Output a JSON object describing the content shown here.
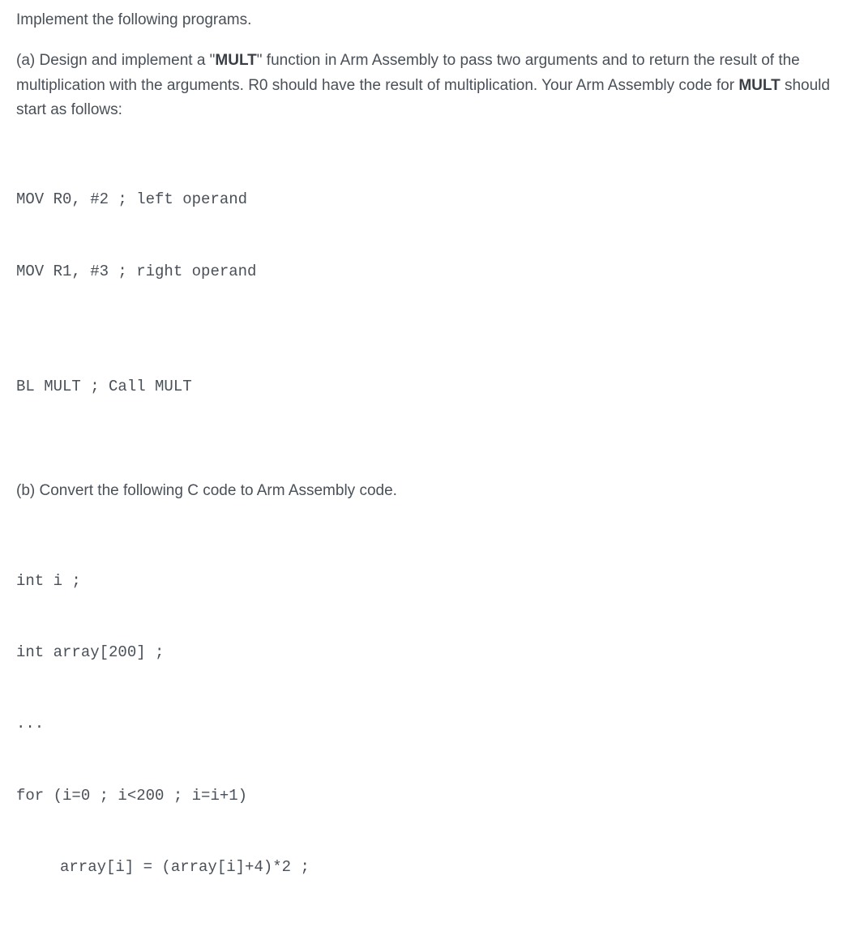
{
  "intro": "Implement the following programs.",
  "partA": {
    "prefix": "(a) Design and implement a \"",
    "bold1": "MULT",
    "mid1": "\" function in Arm Assembly to pass two arguments and to return the result of the multiplication with the arguments. R0 should have the result of multiplication. Your Arm Assembly code for ",
    "bold2": "MULT",
    "suffix": " should start as follows:"
  },
  "codeA1": {
    "line1": "MOV R0, #2 ; left operand",
    "line2": "MOV R1, #3 ; right operand"
  },
  "codeA2": {
    "line1": "BL MULT ; Call MULT"
  },
  "partB": "(b) Convert the following C code to Arm Assembly code.",
  "codeB": {
    "line1": "int i ;",
    "line2": "int array[200] ;",
    "line3": "...",
    "line4": "for (i=0 ; i<200 ; i=i+1)",
    "line5": "array[i] = (array[i]+4)*2 ;"
  }
}
